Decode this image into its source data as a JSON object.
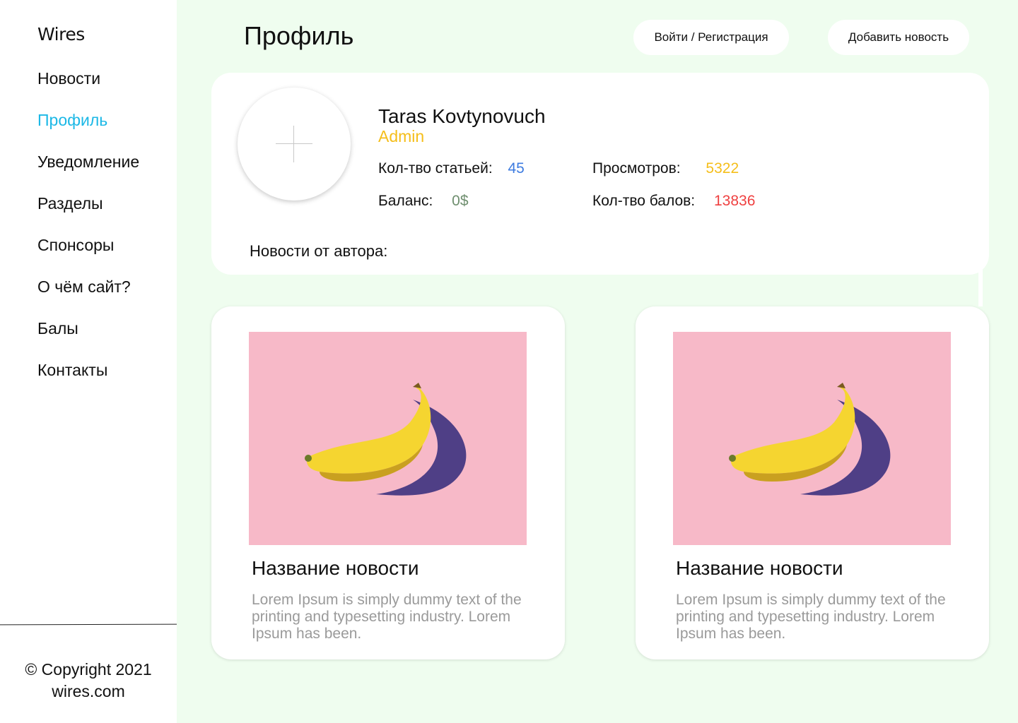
{
  "app": {
    "logo": "Wires"
  },
  "sidebar": {
    "items": [
      {
        "label": "Новости"
      },
      {
        "label": "Профиль",
        "active": true
      },
      {
        "label": "Уведомление"
      },
      {
        "label": "Разделы"
      },
      {
        "label": "Спонсоры"
      },
      {
        "label": "О чём сайт?"
      },
      {
        "label": "Балы"
      },
      {
        "label": "Контакты"
      }
    ],
    "copyright_line1": "© Copyright 2021",
    "copyright_line2": "wires.com"
  },
  "header": {
    "title": "Профиль",
    "login_label": "Войти / Регистрация",
    "add_news_label": "Добавить новость"
  },
  "profile": {
    "name": "Taras Kovtynovuch",
    "role": "Admin",
    "articles_label": "Кол-тво статьей:",
    "articles_value": "45",
    "views_label": "Просмотров:",
    "views_value": "5322",
    "balance_label": "Баланс:",
    "balance_value": "0$",
    "points_label": "Кол-тво балов:",
    "points_value": "13836",
    "authors_news_label": "Новости от автора:"
  },
  "news": [
    {
      "title": "Название новости",
      "text": "Lorem Ipsum is simply dummy text of the printing and typesetting industry. Lorem Ipsum has been.",
      "image": "banana-photo"
    },
    {
      "title": "Название новости",
      "text": "Lorem Ipsum is simply dummy text of the printing and typesetting industry. Lorem Ipsum has been.",
      "image": "banana-photo"
    }
  ],
  "colors": {
    "background": "#effdef",
    "active_nav": "#1cb8e6",
    "role": "#f5be1a",
    "articles_value": "#3d7be0",
    "views_value": "#f5be1a",
    "balance_value": "#6f8f6f",
    "points_value": "#ef4040",
    "image_bg": "#f7b9c8"
  }
}
